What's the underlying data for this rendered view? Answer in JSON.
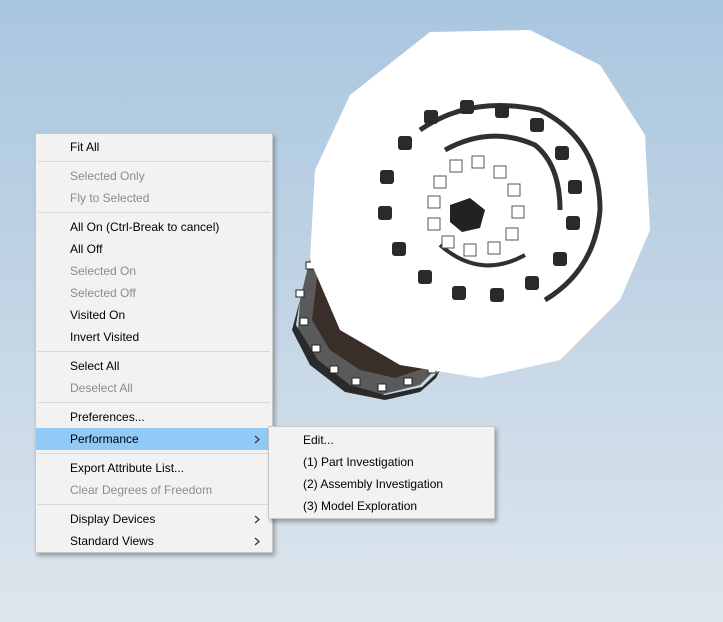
{
  "context_menu": {
    "groups": [
      [
        {
          "label": "Fit All",
          "enabled": true
        }
      ],
      [
        {
          "label": "Selected Only",
          "enabled": false
        },
        {
          "label": "Fly to Selected",
          "enabled": false
        }
      ],
      [
        {
          "label": "All On (Ctrl-Break to cancel)",
          "enabled": true
        },
        {
          "label": "All Off",
          "enabled": true
        },
        {
          "label": "Selected On",
          "enabled": false
        },
        {
          "label": "Selected Off",
          "enabled": false
        },
        {
          "label": "Visited On",
          "enabled": true
        },
        {
          "label": "Invert Visited",
          "enabled": true
        }
      ],
      [
        {
          "label": "Select All",
          "enabled": true
        },
        {
          "label": "Deselect All",
          "enabled": false
        }
      ],
      [
        {
          "label": "Preferences...",
          "enabled": true
        },
        {
          "label": "Performance",
          "enabled": true,
          "submenu": true,
          "highlighted": true
        }
      ],
      [
        {
          "label": "Export Attribute List...",
          "enabled": true
        },
        {
          "label": "Clear Degrees of Freedom",
          "enabled": false
        }
      ],
      [
        {
          "label": "Display Devices",
          "enabled": true,
          "submenu": true
        },
        {
          "label": "Standard Views",
          "enabled": true,
          "submenu": true
        }
      ]
    ]
  },
  "performance_submenu": {
    "items": [
      {
        "label": "Edit..."
      },
      {
        "label": "(1) Part Investigation"
      },
      {
        "label": "(2) Assembly Investigation"
      },
      {
        "label": "(3) Model Exploration"
      }
    ]
  },
  "colors": {
    "background_top": "#a9c6df",
    "background_bottom": "#dde6ee",
    "highlight": "#91c9f7",
    "disabled_text": "#8c8c8c"
  }
}
